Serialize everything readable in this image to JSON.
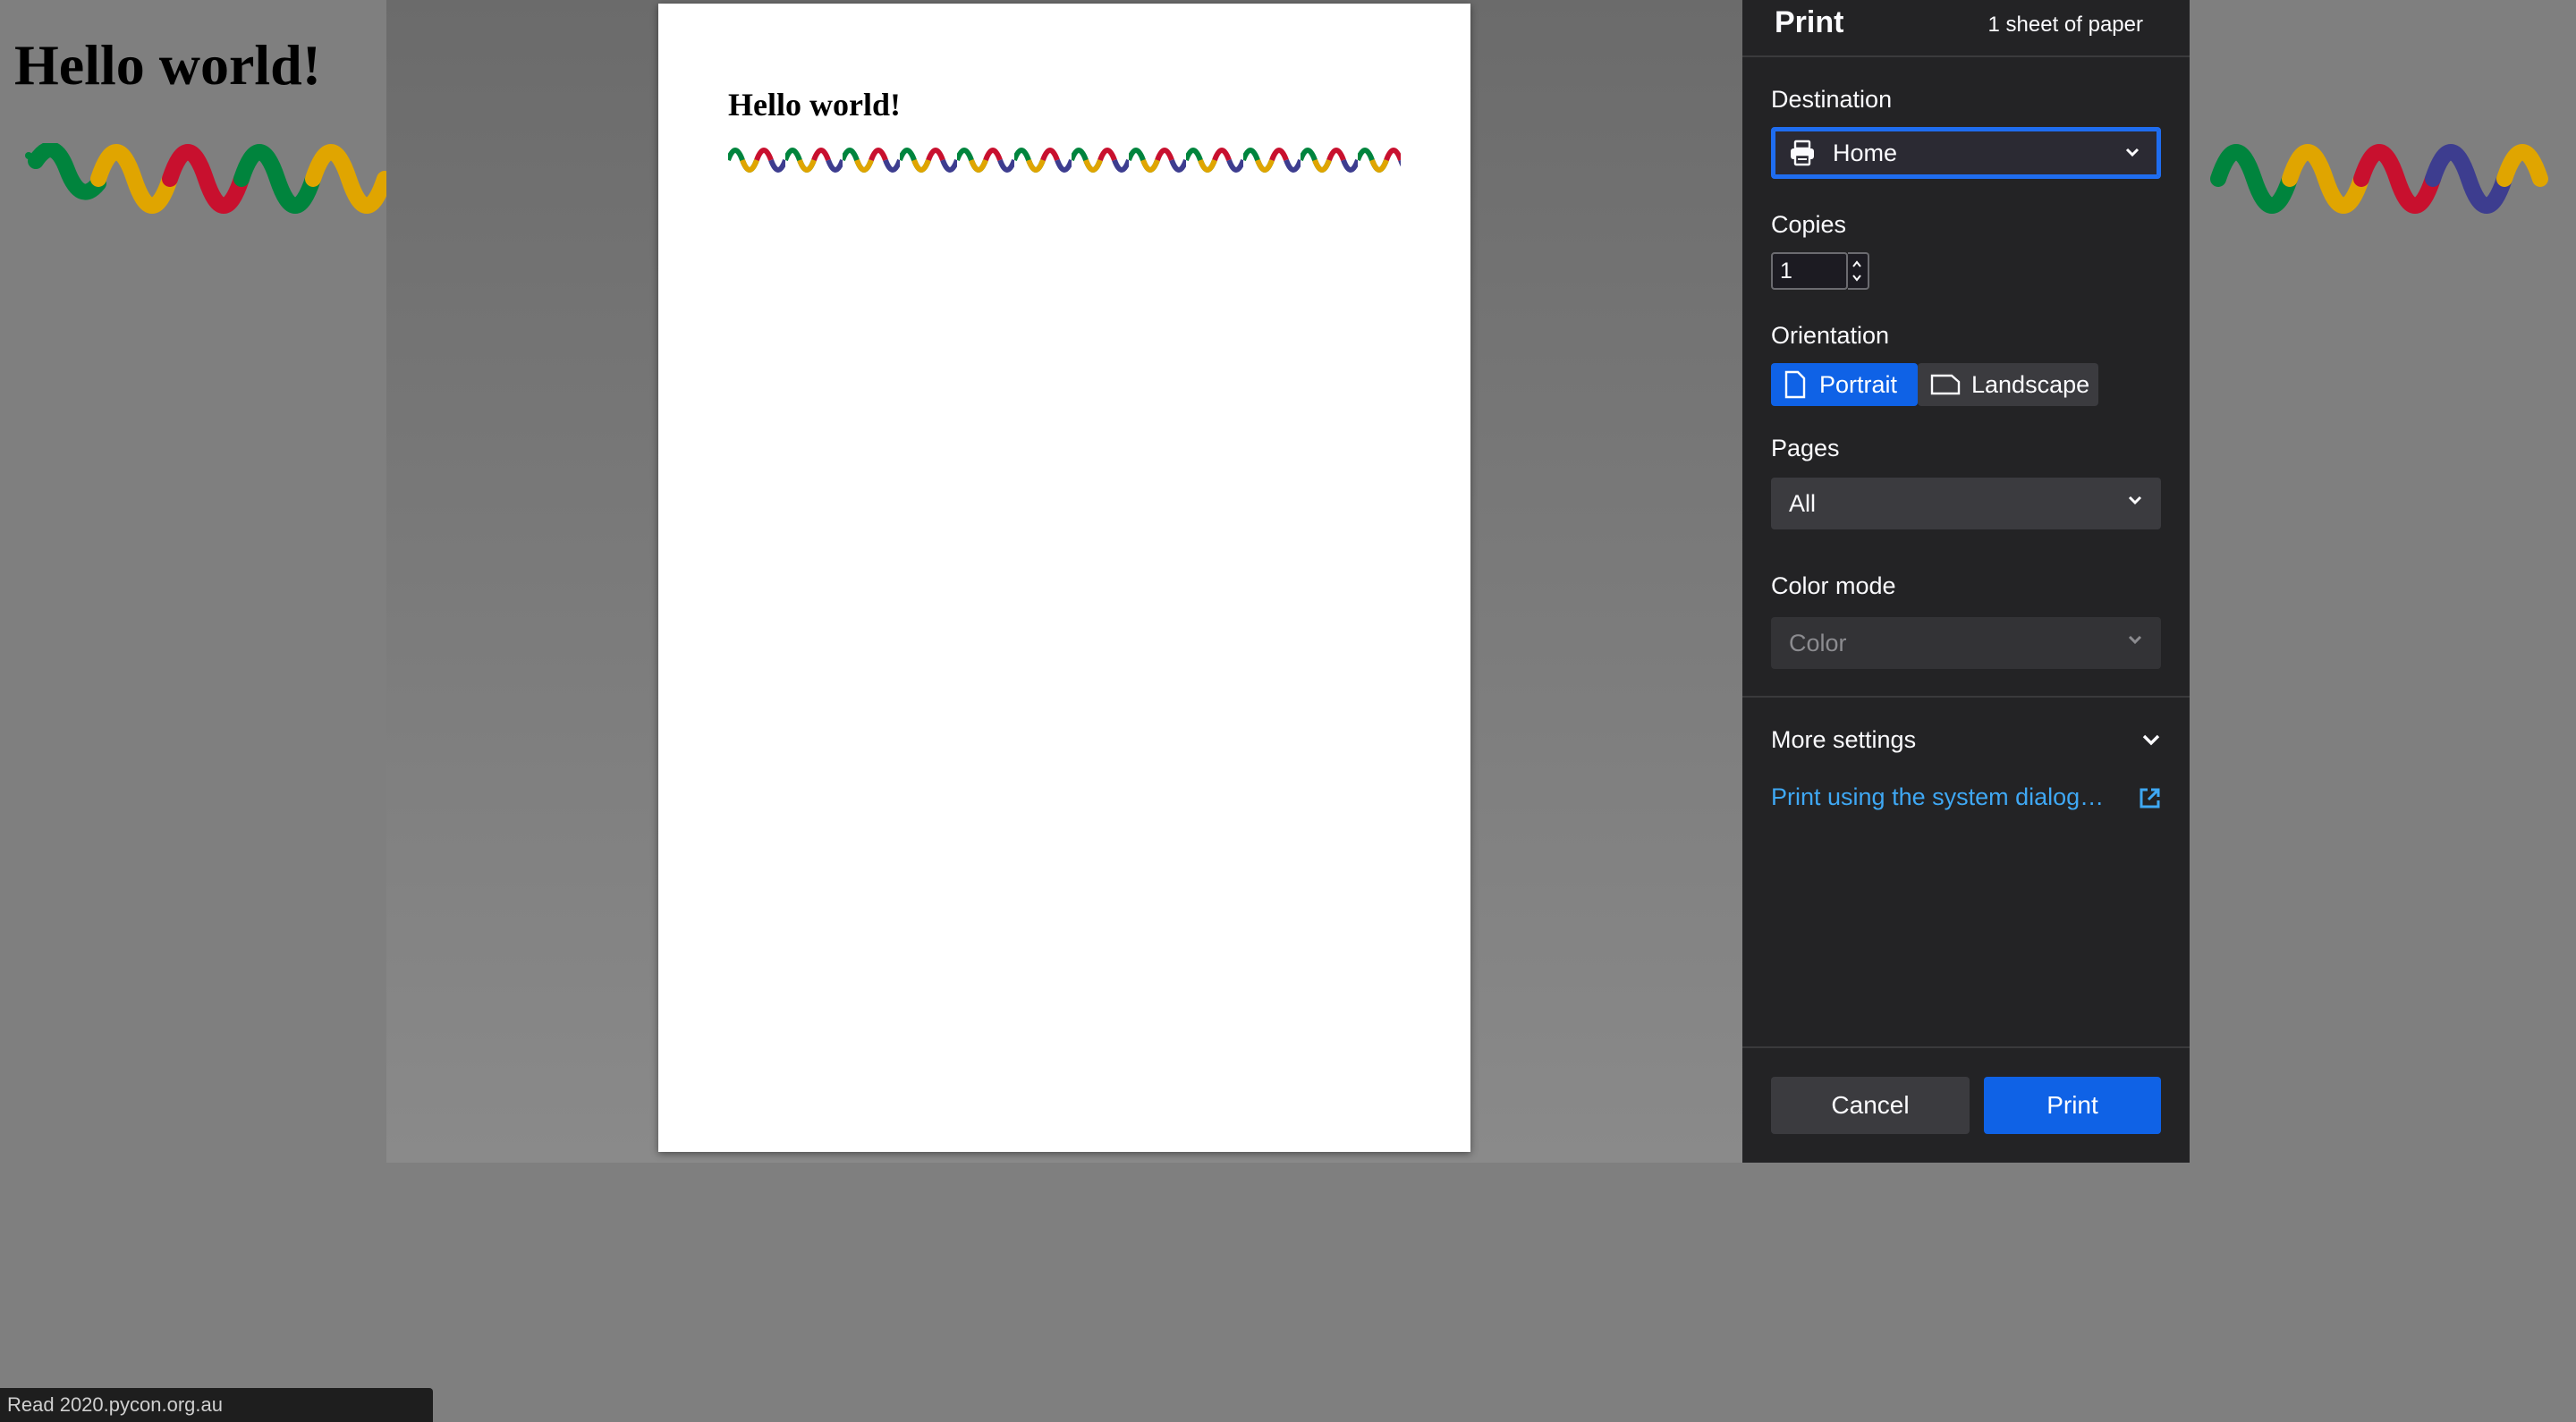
{
  "background_page": {
    "heading": "Hello world!",
    "status_text": "Read 2020.pycon.org.au",
    "snake_colors": [
      "#00843d",
      "#e0a500",
      "#c8102e",
      "#3d3d8f"
    ]
  },
  "preview": {
    "title": "Hello world!"
  },
  "print_dialog": {
    "title": "Print",
    "sheet_count": "1 sheet of paper",
    "destination": {
      "label": "Destination",
      "value": "Home",
      "icon": "printer-icon"
    },
    "copies": {
      "label": "Copies",
      "value": "1"
    },
    "orientation": {
      "label": "Orientation",
      "options": [
        {
          "label": "Portrait",
          "icon": "portrait-page-icon",
          "selected": true
        },
        {
          "label": "Landscape",
          "icon": "landscape-page-icon",
          "selected": false
        }
      ]
    },
    "pages": {
      "label": "Pages",
      "value": "All"
    },
    "color_mode": {
      "label": "Color mode",
      "value": "Color",
      "disabled": true
    },
    "more_settings": "More settings",
    "system_dialog_link": "Print using the system dialog…",
    "cancel_label": "Cancel",
    "print_label": "Print",
    "accent_color": "#0f62e6",
    "link_color": "#3fa8f4"
  }
}
